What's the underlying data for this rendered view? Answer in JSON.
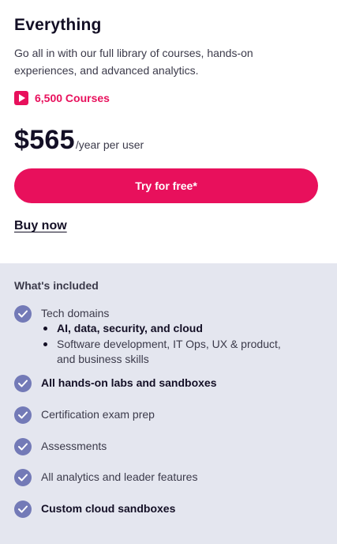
{
  "plan": {
    "title": "Everything",
    "description": "Go all in with our full library of courses, hands-on experiences, and advanced analytics.",
    "courses_label": "6,500 Courses",
    "price": "$565",
    "period": "/year per user",
    "cta_label": "Try for free*",
    "buy_label": "Buy now"
  },
  "included": {
    "title": "What's included",
    "features": [
      {
        "label": "Tech domains",
        "bold": false,
        "sub": [
          "AI, data, security, and cloud",
          "Software development, IT Ops, UX & product, and business skills"
        ]
      },
      {
        "label": "All hands-on labs and sandboxes",
        "bold": true
      },
      {
        "label": "Certification exam prep",
        "bold": false
      },
      {
        "label": "Assessments",
        "bold": false
      },
      {
        "label": "All analytics and leader features",
        "bold": false
      },
      {
        "label": "Custom cloud sandboxes",
        "bold": true
      }
    ]
  },
  "colors": {
    "accent": "#e8105c",
    "check": "#737ab7",
    "included_bg": "#e4e6ef",
    "text": "#130f25"
  },
  "icons": {
    "courses": "play-icon",
    "feature": "check-icon"
  }
}
